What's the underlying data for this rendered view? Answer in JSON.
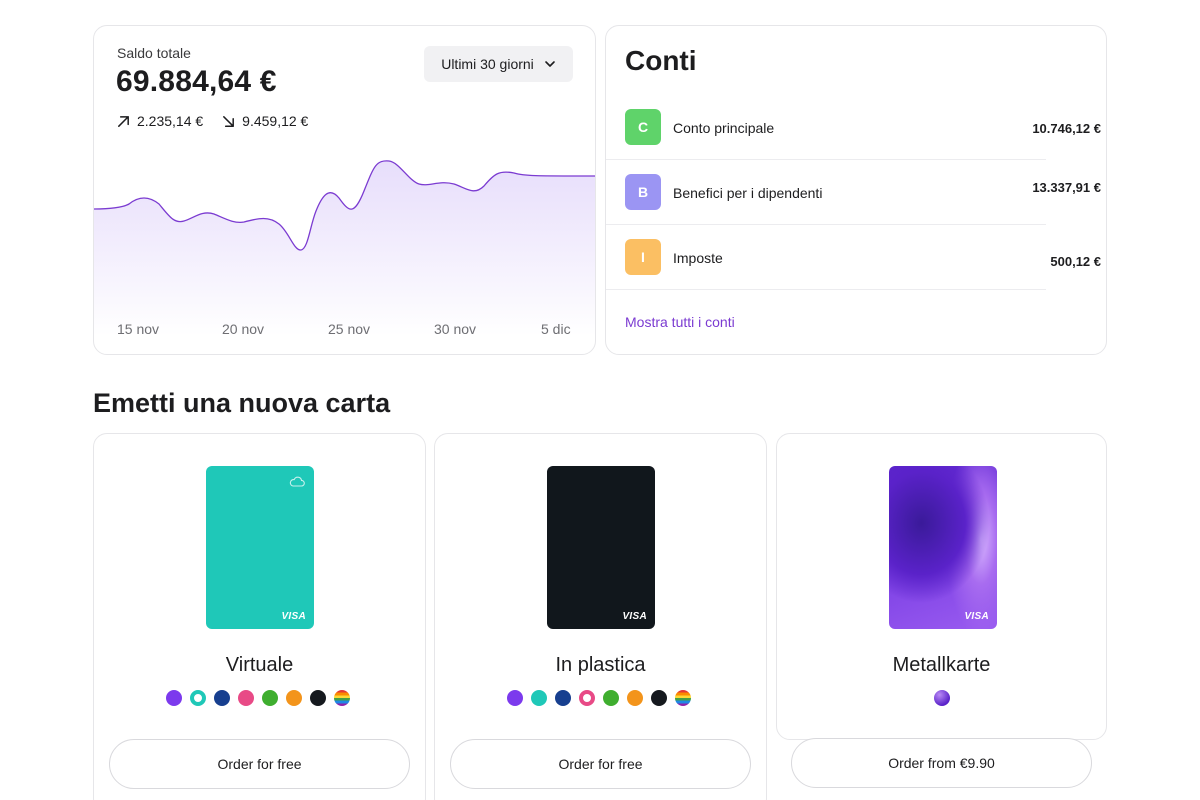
{
  "balance": {
    "label": "Saldo totale",
    "amount": "69.884,64 €",
    "incoming": "2.235,14 €",
    "outgoing": "9.459,12 €",
    "period": "Ultimi 30 giorni",
    "x_labels": [
      "15 nov",
      "20 nov",
      "25 nov",
      "30 nov",
      "5 dic"
    ],
    "accent": "#7b3bd1"
  },
  "accounts": {
    "title": "Conti",
    "items": [
      {
        "letter": "C",
        "name": "Conto principale",
        "value": "10.746,12 €",
        "color": "#5fd36a"
      },
      {
        "letter": "B",
        "name": "Benefici per i dipendenti",
        "value": "13.337,91 €",
        "color": "#9b95f3"
      },
      {
        "letter": "I",
        "name": "Imposte",
        "value": "500,12 €",
        "color": "#fbbf63"
      }
    ],
    "show_all": "Mostra tutti i conti"
  },
  "new_card": {
    "title": "Emetti una nuova carta",
    "options": [
      {
        "name": "Virtuale",
        "card_brand": "VISA",
        "order_label": "Order for free",
        "card_color": "#1fc8b8",
        "swatches": [
          "#7c3aed",
          "#1fc8b8",
          "#173f8f",
          "#e84a86",
          "#3fae2f",
          "#f3941b",
          "#15191e",
          "rainbow"
        ],
        "selected_swatch": 1
      },
      {
        "name": "In plastica",
        "card_brand": "VISA",
        "order_label": "Order for free",
        "card_color": "#11171c",
        "swatches": [
          "#7c3aed",
          "#1fc8b8",
          "#173f8f",
          "#e84a86",
          "#3fae2f",
          "#f3941b",
          "#15191e",
          "rainbow"
        ],
        "selected_swatch": 3
      },
      {
        "name": "Metallkarte",
        "card_brand": "VISA",
        "order_label": "Order from €9.90",
        "card_color": "#6a2ad3",
        "swatches": [
          "#6a2ad3"
        ],
        "selected_swatch": -1
      }
    ]
  }
}
